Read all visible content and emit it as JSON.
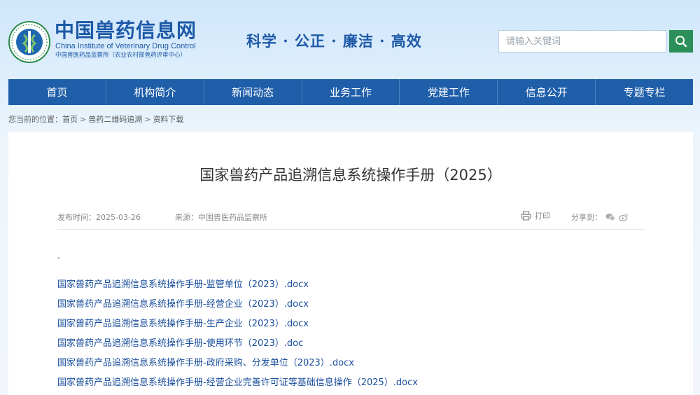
{
  "header": {
    "logo_cn": "中国兽药信息网",
    "logo_en": "China Institute of Veterinary Drug Control",
    "logo_sub": "中国兽医药品监察所（农业农村部兽药评审中心）",
    "slogan": "科学 · 公正 · 廉洁 · 高效",
    "search_placeholder": "请输入关键词",
    "search_icon": "search-icon"
  },
  "nav": {
    "items": [
      "首页",
      "机构简介",
      "新闻动态",
      "业务工作",
      "党建工作",
      "信息公开",
      "专题专栏"
    ]
  },
  "breadcrumb": {
    "prefix": "您当前的位置：",
    "items": [
      "首页",
      "兽药二维码追溯",
      "资料下载"
    ],
    "separator": ">"
  },
  "article": {
    "title": "国家兽药产品追溯信息系统操作手册（2025）",
    "date_label": "发布时间：",
    "date": "2025-03-26",
    "source_label": "来源：",
    "source": "中国兽医药品监察所",
    "print_label": "打印",
    "share_label": "分享到：",
    "dot": ".",
    "files": [
      "国家兽药产品追溯信息系统操作手册-监管单位（2023）.docx",
      "国家兽药产品追溯信息系统操作手册-经营企业（2023）.docx",
      "国家兽药产品追溯信息系统操作手册-生产企业（2023）.docx",
      "国家兽药产品追溯信息系统操作手册-使用环节（2023）.doc",
      "国家兽药产品追溯信息系统操作手册-政府采购、分发单位（2023）.docx",
      "国家兽药产品追溯信息系统操作手册-经营企业完善许可证等基础信息操作（2025）.docx"
    ]
  },
  "colors": {
    "brand_blue": "#1d59a7",
    "nav_blue": "#1f5ea9",
    "search_green": "#2a8f58",
    "link_blue": "#1a4f9c"
  }
}
